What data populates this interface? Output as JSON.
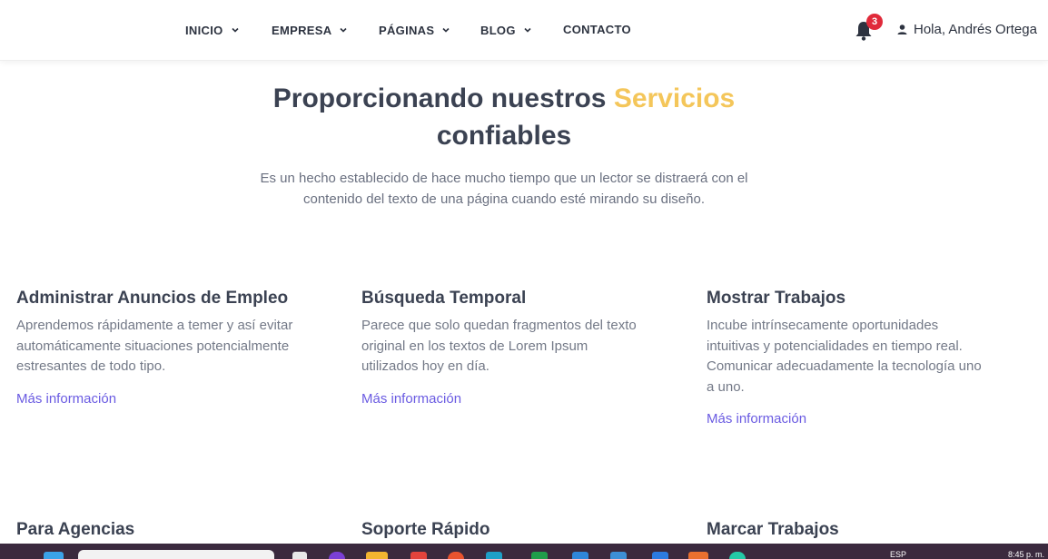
{
  "nav": {
    "items": [
      {
        "label": "INICIO",
        "has_dropdown": true
      },
      {
        "label": "EMPRESA",
        "has_dropdown": true
      },
      {
        "label": "PÁGINAS",
        "has_dropdown": true
      },
      {
        "label": "BLOG",
        "has_dropdown": true
      },
      {
        "label": "CONTACTO",
        "has_dropdown": false
      }
    ],
    "notifications_count": "3",
    "user_greeting": "Hola, Andrés Ortega"
  },
  "hero": {
    "title_part1": "Proporcionando nuestros",
    "title_accent": "Servicios",
    "title_part2": "confiables",
    "subtitle": "Es un hecho establecido de hace mucho tiempo que un lector se distraerá con el contenido del texto de una página cuando esté mirando su diseño."
  },
  "services": [
    {
      "title": "Administrar Anuncios de Empleo",
      "description": "Aprendemos rápidamente a temer y así evitar automáticamente situaciones potencialmente estresantes de todo tipo.",
      "link": "Más información"
    },
    {
      "title": "Búsqueda Temporal",
      "description": "Parece que solo quedan fragmentos del texto original en los textos de Lorem Ipsum utilizados hoy en día.",
      "link": "Más información"
    },
    {
      "title": "Mostrar Trabajos",
      "description": "Incube intrínsecamente oportunidades intuitivas y potencialidades en tiempo real. Comunicar adecuadamente la tecnología uno a uno.",
      "link": "Más información"
    },
    {
      "title": "Para Agencias"
    },
    {
      "title": "Soporte Rápido"
    },
    {
      "title": "Marcar Trabajos"
    }
  ],
  "taskbar": {
    "language": "ESP",
    "time": "8:45 p. m."
  },
  "colors": {
    "accent": "#f4c65a",
    "link": "#6a5be2",
    "badge": "#e02a3a",
    "text_dark": "#3b4252",
    "text_muted": "#737987"
  }
}
